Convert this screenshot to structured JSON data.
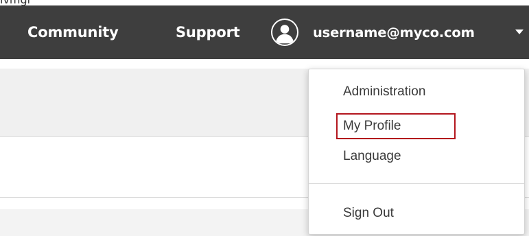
{
  "header": {
    "nav_links": [
      "Community",
      "Support"
    ],
    "username": "username@myco.com"
  },
  "user_menu": {
    "items": [
      "Administration",
      "My Profile",
      "Language"
    ],
    "sign_out": "Sign Out",
    "highlighted_item": "My Profile"
  },
  "colors": {
    "navbar_bg": "#3e3e3e",
    "highlight_border": "#b3151d"
  },
  "icons": [
    "user-avatar-icon",
    "caret-down-icon"
  ]
}
